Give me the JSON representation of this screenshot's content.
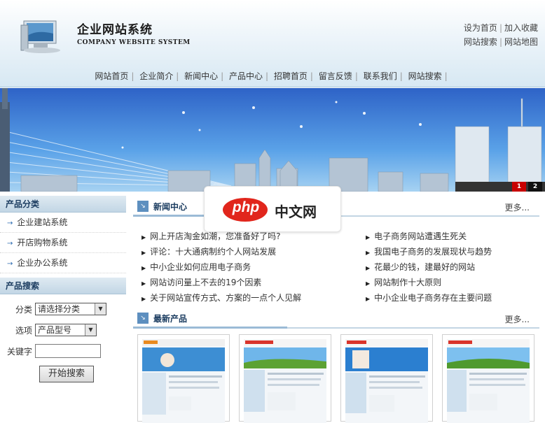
{
  "header": {
    "title": "企业网站系统",
    "subtitle": "COMPANY WEBSITE SYSTEM",
    "links": [
      "设为首页",
      "加入收藏",
      "网站搜索",
      "网站地图"
    ]
  },
  "nav": [
    "网站首页",
    "企业简介",
    "新闻中心",
    "产品中心",
    "招聘首页",
    "留言反馈",
    "联系我们",
    "网站搜索"
  ],
  "banner": {
    "pages": [
      "1",
      "2"
    ]
  },
  "left": {
    "category_title": "产品分类",
    "categories": [
      "企业建站系统",
      "开店购物系统",
      "企业办公系统"
    ],
    "search_title": "产品搜索",
    "search": {
      "category_label": "分类",
      "category_value": "请选择分类",
      "option_label": "选项",
      "option_value": "产品型号",
      "keyword_label": "关键字",
      "button": "开始搜索"
    }
  },
  "news": {
    "title": "新闻中心",
    "more": "更多...",
    "left": [
      "网上开店淘金如潮，您准备好了吗?",
      "评论：十大通病制约个人网站发展",
      "中小企业如何应用电子商务",
      "网站访问量上不去的19个因素",
      "关于网站宣传方式、方案的一点个人见解"
    ],
    "right": [
      "电子商务网站遭遇生死关",
      "我国电子商务的发展现状与趋势",
      "花最少的钱，建最好的网站",
      "网站制作十大原则",
      "中小企业电子商务存在主要问题"
    ]
  },
  "products": {
    "title": "最新产品",
    "more": "更多...",
    "count": 4
  },
  "watermark": {
    "brand": "php",
    "text": "中文网"
  },
  "colors": {
    "accent": "#1b3c60",
    "watermark_red": "#e1261c"
  }
}
